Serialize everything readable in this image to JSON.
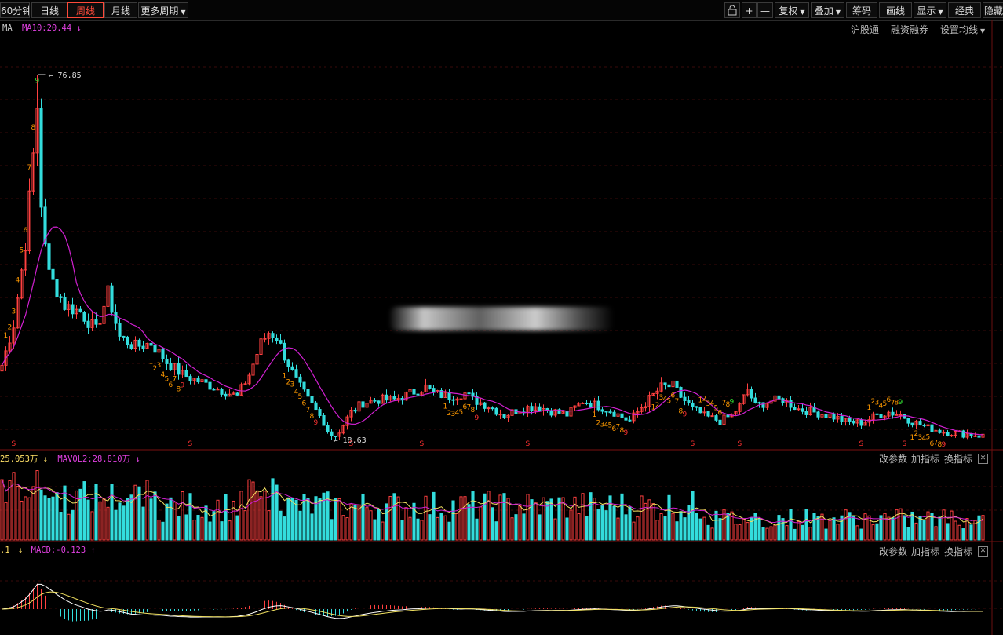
{
  "toolbar": {
    "left": [
      {
        "label": "60分钟",
        "active": false
      },
      {
        "label": "日线",
        "active": false
      },
      {
        "label": "周线",
        "active": true
      },
      {
        "label": "月线",
        "active": false
      },
      {
        "label": "更多周期",
        "active": false,
        "caret": true
      }
    ],
    "right": [
      {
        "label": "",
        "icon": "lock-icon"
      },
      {
        "label": "+",
        "icon": "zoom-in-icon"
      },
      {
        "label": "—",
        "icon": "zoom-out-icon"
      },
      {
        "label": "复权",
        "caret": true
      },
      {
        "label": "叠加",
        "caret": true
      },
      {
        "label": "筹码"
      },
      {
        "label": "画线"
      },
      {
        "label": "显示",
        "caret": true
      },
      {
        "label": "经典"
      },
      {
        "label": "隐藏"
      }
    ]
  },
  "main_panel": {
    "indicator_name": "MA",
    "ma_text": "MA10:20.44",
    "ma_arrow": "↓",
    "links": [
      "沪股通",
      "融资融券",
      "设置均线"
    ],
    "high_label": "76.85",
    "low_label": "18.63",
    "s_marker": "S"
  },
  "vol_panel": {
    "vol_text": "25.053万",
    "vol_arrow": "↓",
    "mavol_text": "MAVOL2:28.810万",
    "mavol_arrow": "↓",
    "links": [
      "改参数",
      "加指标",
      "换指标"
    ],
    "close_label": "✕"
  },
  "macd_panel": {
    "prefix_text": ".1",
    "prefix_arrow": "↓",
    "macd_text": "MACD:-0.123",
    "macd_arrow": "↑",
    "links": [
      "改参数",
      "加指标",
      "换指标"
    ],
    "close_label": "✕"
  },
  "colors": {
    "up": "#ff4040",
    "down": "#33dddd",
    "ma": "#d020d0",
    "accent": "#ff4a3a",
    "nine_orange": "#ff9900",
    "nine_red": "#ff3333",
    "nine_green": "#33dd33"
  },
  "chart_data": {
    "type": "candlestick",
    "price_range": [
      18.63,
      76.85
    ],
    "high": 76.85,
    "low": 18.63,
    "ma_period": 10,
    "ma_last": 20.44,
    "mavol_period": 2,
    "mavol_last": 288100,
    "volume_last": 250530,
    "macd_last": -0.123,
    "sequence_digits": [
      "1",
      "2",
      "3",
      "4",
      "5",
      "6",
      "7",
      "8",
      "9"
    ],
    "anchors": [
      [
        0,
        30.5
      ],
      [
        3,
        37
      ],
      [
        6,
        50
      ],
      [
        8,
        64
      ],
      [
        9,
        76.85
      ],
      [
        10,
        56
      ],
      [
        12,
        45
      ],
      [
        16,
        40
      ],
      [
        20,
        39
      ],
      [
        24,
        36
      ],
      [
        27,
        42
      ],
      [
        30,
        35
      ],
      [
        34,
        33.5
      ],
      [
        38,
        34
      ],
      [
        42,
        31
      ],
      [
        46,
        29
      ],
      [
        50,
        28
      ],
      [
        54,
        27
      ],
      [
        58,
        26
      ],
      [
        60,
        25.5
      ],
      [
        63,
        29
      ],
      [
        66,
        34
      ],
      [
        68,
        35.7
      ],
      [
        70,
        35
      ],
      [
        72,
        32
      ],
      [
        75,
        28
      ],
      [
        78,
        25
      ],
      [
        82,
        21.5
      ],
      [
        84,
        18.63
      ],
      [
        86,
        20
      ],
      [
        89,
        23
      ],
      [
        92,
        24.5
      ],
      [
        96,
        25
      ],
      [
        100,
        25
      ],
      [
        104,
        26
      ],
      [
        108,
        27
      ],
      [
        110,
        26
      ],
      [
        114,
        25.5
      ],
      [
        118,
        26
      ],
      [
        120,
        25
      ],
      [
        124,
        24
      ],
      [
        128,
        22.5
      ],
      [
        132,
        23.5
      ],
      [
        136,
        24
      ],
      [
        140,
        23.2
      ],
      [
        144,
        22.6
      ],
      [
        148,
        24.8
      ],
      [
        152,
        24
      ],
      [
        156,
        23
      ],
      [
        158,
        22.2
      ],
      [
        160,
        21.6
      ],
      [
        163,
        23.8
      ],
      [
        168,
        27
      ],
      [
        171,
        27.2
      ],
      [
        173,
        25.5
      ],
      [
        176,
        23.5
      ],
      [
        180,
        22.2
      ],
      [
        183,
        21.6
      ],
      [
        186,
        22.5
      ],
      [
        188,
        24
      ],
      [
        190,
        26.7
      ],
      [
        192,
        24
      ],
      [
        196,
        24.8
      ],
      [
        199,
        25
      ],
      [
        203,
        23.5
      ],
      [
        207,
        23
      ],
      [
        211,
        22.5
      ],
      [
        215,
        21.5
      ],
      [
        219,
        21.3
      ],
      [
        223,
        22.5
      ],
      [
        226,
        23
      ],
      [
        229,
        22.6
      ],
      [
        232,
        21.5
      ],
      [
        236,
        20.5
      ],
      [
        240,
        19.9
      ],
      [
        244,
        19.6
      ],
      [
        248,
        19.4
      ],
      [
        250,
        19.2
      ]
    ]
  }
}
